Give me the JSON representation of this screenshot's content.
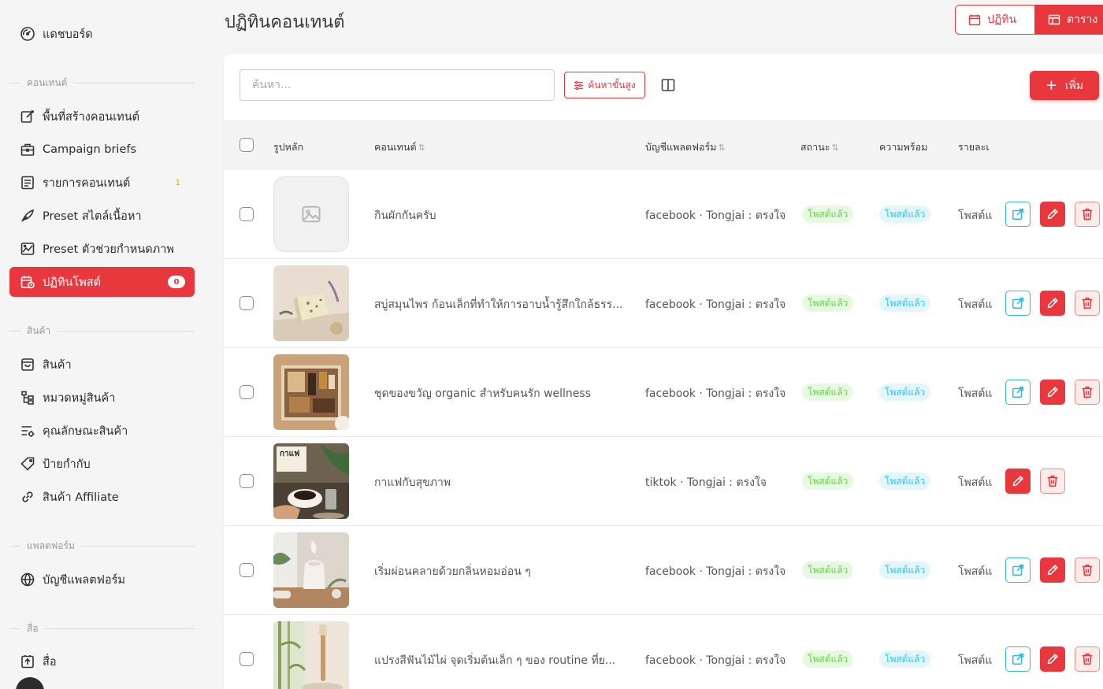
{
  "sidebar": {
    "dashboard": "แดชบอร์ด",
    "sections": [
      "คอนเทนต์",
      "สินค้า",
      "แพลตฟอร์ม",
      "สื่อ"
    ],
    "content_items": [
      {
        "label": "พื้นที่สร้างคอนเทนต์",
        "icon": "edit-square-icon"
      },
      {
        "label": "Campaign briefs",
        "icon": "briefcase-icon"
      },
      {
        "label": "รายการคอนเทนต์",
        "icon": "list-document-icon",
        "badge": "1"
      },
      {
        "label": "Preset สไตล์เนื้อหา",
        "icon": "feather-pen-icon"
      },
      {
        "label": "Preset ตัวช่วยกำหนดภาพ",
        "icon": "image-chart-icon"
      },
      {
        "label": "ปฏิทินโพสต์",
        "icon": "calendar-clock-icon",
        "badge": "0",
        "active": true
      }
    ],
    "product_items": [
      {
        "label": "สินค้า",
        "icon": "shopping-bag-icon"
      },
      {
        "label": "หมวดหมู่สินค้า",
        "icon": "category-tree-icon"
      },
      {
        "label": "คุณลักษณะสินค้า",
        "icon": "attribute-settings-icon"
      },
      {
        "label": "ป้ายกำกับ",
        "icon": "tag-icon"
      },
      {
        "label": "สินค้า Affiliate",
        "icon": "link-icon"
      }
    ],
    "platform_items": [
      {
        "label": "บัญชีแพลตฟอร์ม",
        "icon": "globe-icon"
      }
    ],
    "media_items": [
      {
        "label": "สื่อ",
        "icon": "media-upload-icon"
      }
    ]
  },
  "header": {
    "title": "ปฏิทินคอนเทนต์",
    "view_calendar": "ปฏิทิน",
    "view_table": "ตาราง"
  },
  "toolbar": {
    "search_placeholder": "ค้นหา...",
    "advanced_search": "ค้นหาขั้นสูง",
    "add_label": "เพิ่ม"
  },
  "table": {
    "columns": {
      "image": "รูปหลัก",
      "content": "คอนเทนต์",
      "account": "บัญชีแพลตฟอร์ม",
      "status": "สถานะ",
      "readiness": "ความพร้อม",
      "details": "รายละเ"
    },
    "rows": [
      {
        "content": "กินผักกันครับ",
        "account": "facebook · Tongjai : ตรงใจ",
        "status": "โพสต์แล้ว",
        "readiness": "โพสต์แล้ว",
        "details": "โพสต์แ",
        "thumb": "placeholder",
        "has_open": true
      },
      {
        "content": "สบู่สมุนไพร ก้อนเล็กที่ทำให้การอาบน้ำรู้สึกใกล้ธรร...",
        "account": "facebook · Tongjai : ตรงใจ",
        "status": "โพสต์แล้ว",
        "readiness": "โพสต์แล้ว",
        "details": "โพสต์แ",
        "thumb": "soap",
        "has_open": true
      },
      {
        "content": "ชุดของขวัญ organic สำหรับคนรัก wellness",
        "account": "facebook · Tongjai : ตรงใจ",
        "status": "โพสต์แล้ว",
        "readiness": "โพสต์แล้ว",
        "details": "โพสต์แ",
        "thumb": "giftbox",
        "has_open": true
      },
      {
        "content": "กาแฟกับสุขภาพ",
        "account": "tiktok · Tongjai : ตรงใจ",
        "status": "โพสต์แล้ว",
        "readiness": "โพสต์แล้ว",
        "details": "โพสต์แ",
        "thumb": "coffee",
        "thumb_text": "กาแฟ",
        "has_open": false
      },
      {
        "content": "เริ่มผ่อนคลายด้วยกลิ่นหอมอ่อน ๆ",
        "account": "facebook · Tongjai : ตรงใจ",
        "status": "โพสต์แล้ว",
        "readiness": "โพสต์แล้ว",
        "details": "โพสต์แ",
        "thumb": "diffuser",
        "has_open": true
      },
      {
        "content": "แปรงสีฟันไม้ไผ่ จุดเริ่มต้นเล็ก ๆ ของ routine ที่ย...",
        "account": "facebook · Tongjai : ตรงใจ",
        "status": "โพสต์แล้ว",
        "readiness": "โพสต์แล้ว",
        "details": "โพสต์แ",
        "thumb": "bamboo",
        "has_open": true
      }
    ]
  },
  "colors": {
    "accent": "#e8373d",
    "status_green": "#62d441",
    "status_cyan": "#2cc4ee"
  }
}
